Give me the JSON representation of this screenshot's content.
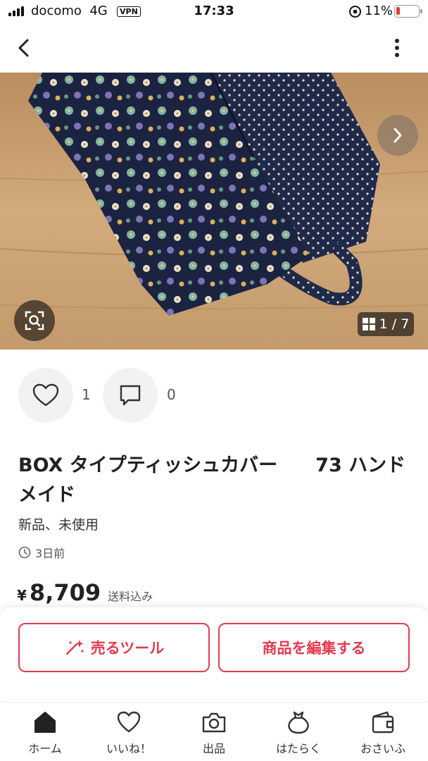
{
  "status_bar": {
    "carrier": "docomo",
    "network": "4G",
    "vpn": "VPN",
    "time": "17:33",
    "battery": "11%"
  },
  "nav": {
    "back_icon": "chevron-left-icon",
    "more_icon": "kebab-icon"
  },
  "gallery": {
    "counter": "1 / 7",
    "current": 1,
    "total": 7
  },
  "actions": {
    "likes": "1",
    "comments": "0"
  },
  "item": {
    "title": "BOX タイプティッシュカバー　　73 ハンドメイド",
    "condition": "新品、未使用",
    "posted": "3日前",
    "currency": "¥",
    "price": "8,709",
    "shipping": "送料込み"
  },
  "buttons": {
    "sell_tool": "売るツール",
    "edit_item": "商品を編集する"
  },
  "tabs": [
    {
      "label": "ホーム",
      "icon": "home-icon"
    },
    {
      "label": "いいね！",
      "icon": "heart-icon"
    },
    {
      "label": "出品",
      "icon": "camera-icon"
    },
    {
      "label": "はたらく",
      "icon": "money-bag-icon"
    },
    {
      "label": "おさいふ",
      "icon": "wallet-icon"
    }
  ],
  "colors": {
    "accent": "#e33a4f",
    "text": "#222222"
  }
}
